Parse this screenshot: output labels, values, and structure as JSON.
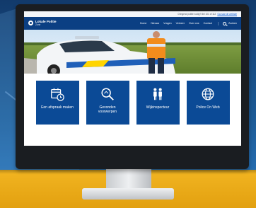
{
  "utility_bar": {
    "text": "Dringend politie nodig? Bel 101 of 112",
    "link": "Ga naar de website"
  },
  "header": {
    "logo_title": "Lokale Politie",
    "logo_subtitle": "Zone",
    "menu": [
      "Home",
      "Nieuws",
      "Vragen",
      "Verkeer",
      "Over ons",
      "Contact"
    ],
    "search_label": "Zoeken"
  },
  "hero": {
    "car_label": "Politie"
  },
  "tiles": [
    {
      "label": "Een afspraak maken",
      "icon": "calendar-clock-icon"
    },
    {
      "label": "Gevonden voorwerpen",
      "icon": "magnifier-icon"
    },
    {
      "label": "Wijkinspecteur",
      "icon": "people-icon"
    },
    {
      "label": "Police On Web",
      "icon": "globe-icon"
    }
  ],
  "colors": {
    "brand_blue": "#0b3f83",
    "tile_blue": "#0b4a96",
    "desk_yellow": "#f2b521",
    "background_blue": "#1c5a96"
  }
}
